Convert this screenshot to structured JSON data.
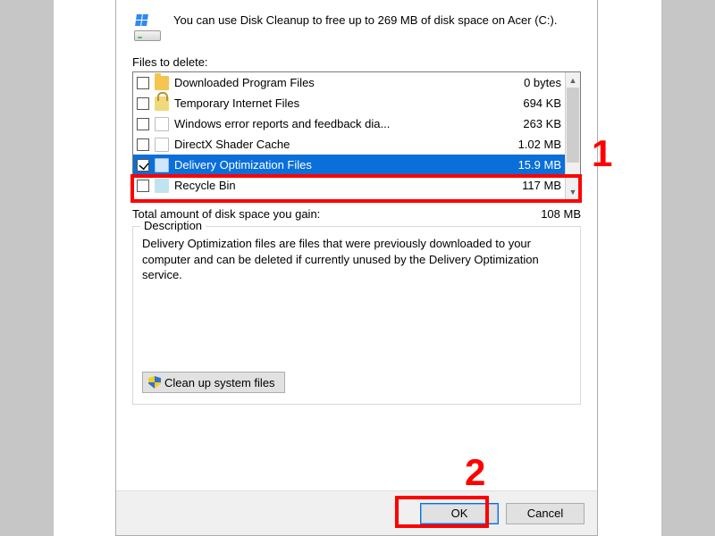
{
  "intro_text": "You can use Disk Cleanup to free up to 269 MB of disk space on Acer (C:).",
  "files_label": "Files to delete:",
  "rows": [
    {
      "label": "Downloaded Program Files",
      "size": "0 bytes",
      "checked": false,
      "icon": "folder",
      "selected": false
    },
    {
      "label": "Temporary Internet Files",
      "size": "694 KB",
      "checked": false,
      "icon": "lock",
      "selected": false
    },
    {
      "label": "Windows error reports and feedback dia...",
      "size": "263 KB",
      "checked": false,
      "icon": "doc",
      "selected": false
    },
    {
      "label": "DirectX Shader Cache",
      "size": "1.02 MB",
      "checked": false,
      "icon": "doc",
      "selected": false
    },
    {
      "label": "Delivery Optimization Files",
      "size": "15.9 MB",
      "checked": true,
      "icon": "page",
      "selected": true
    },
    {
      "label": "Recycle Bin",
      "size": "117 MB",
      "checked": false,
      "icon": "recycle",
      "selected": false
    }
  ],
  "total_label": "Total amount of disk space you gain:",
  "total_value": "108 MB",
  "description": {
    "legend": "Description",
    "text": "Delivery Optimization files are files that were previously downloaded to your computer and can be deleted if currently unused by the Delivery Optimization service."
  },
  "sysfiles_button": "Clean up system files",
  "ok_label": "OK",
  "cancel_label": "Cancel",
  "annotations": {
    "one": "1",
    "two": "2"
  }
}
